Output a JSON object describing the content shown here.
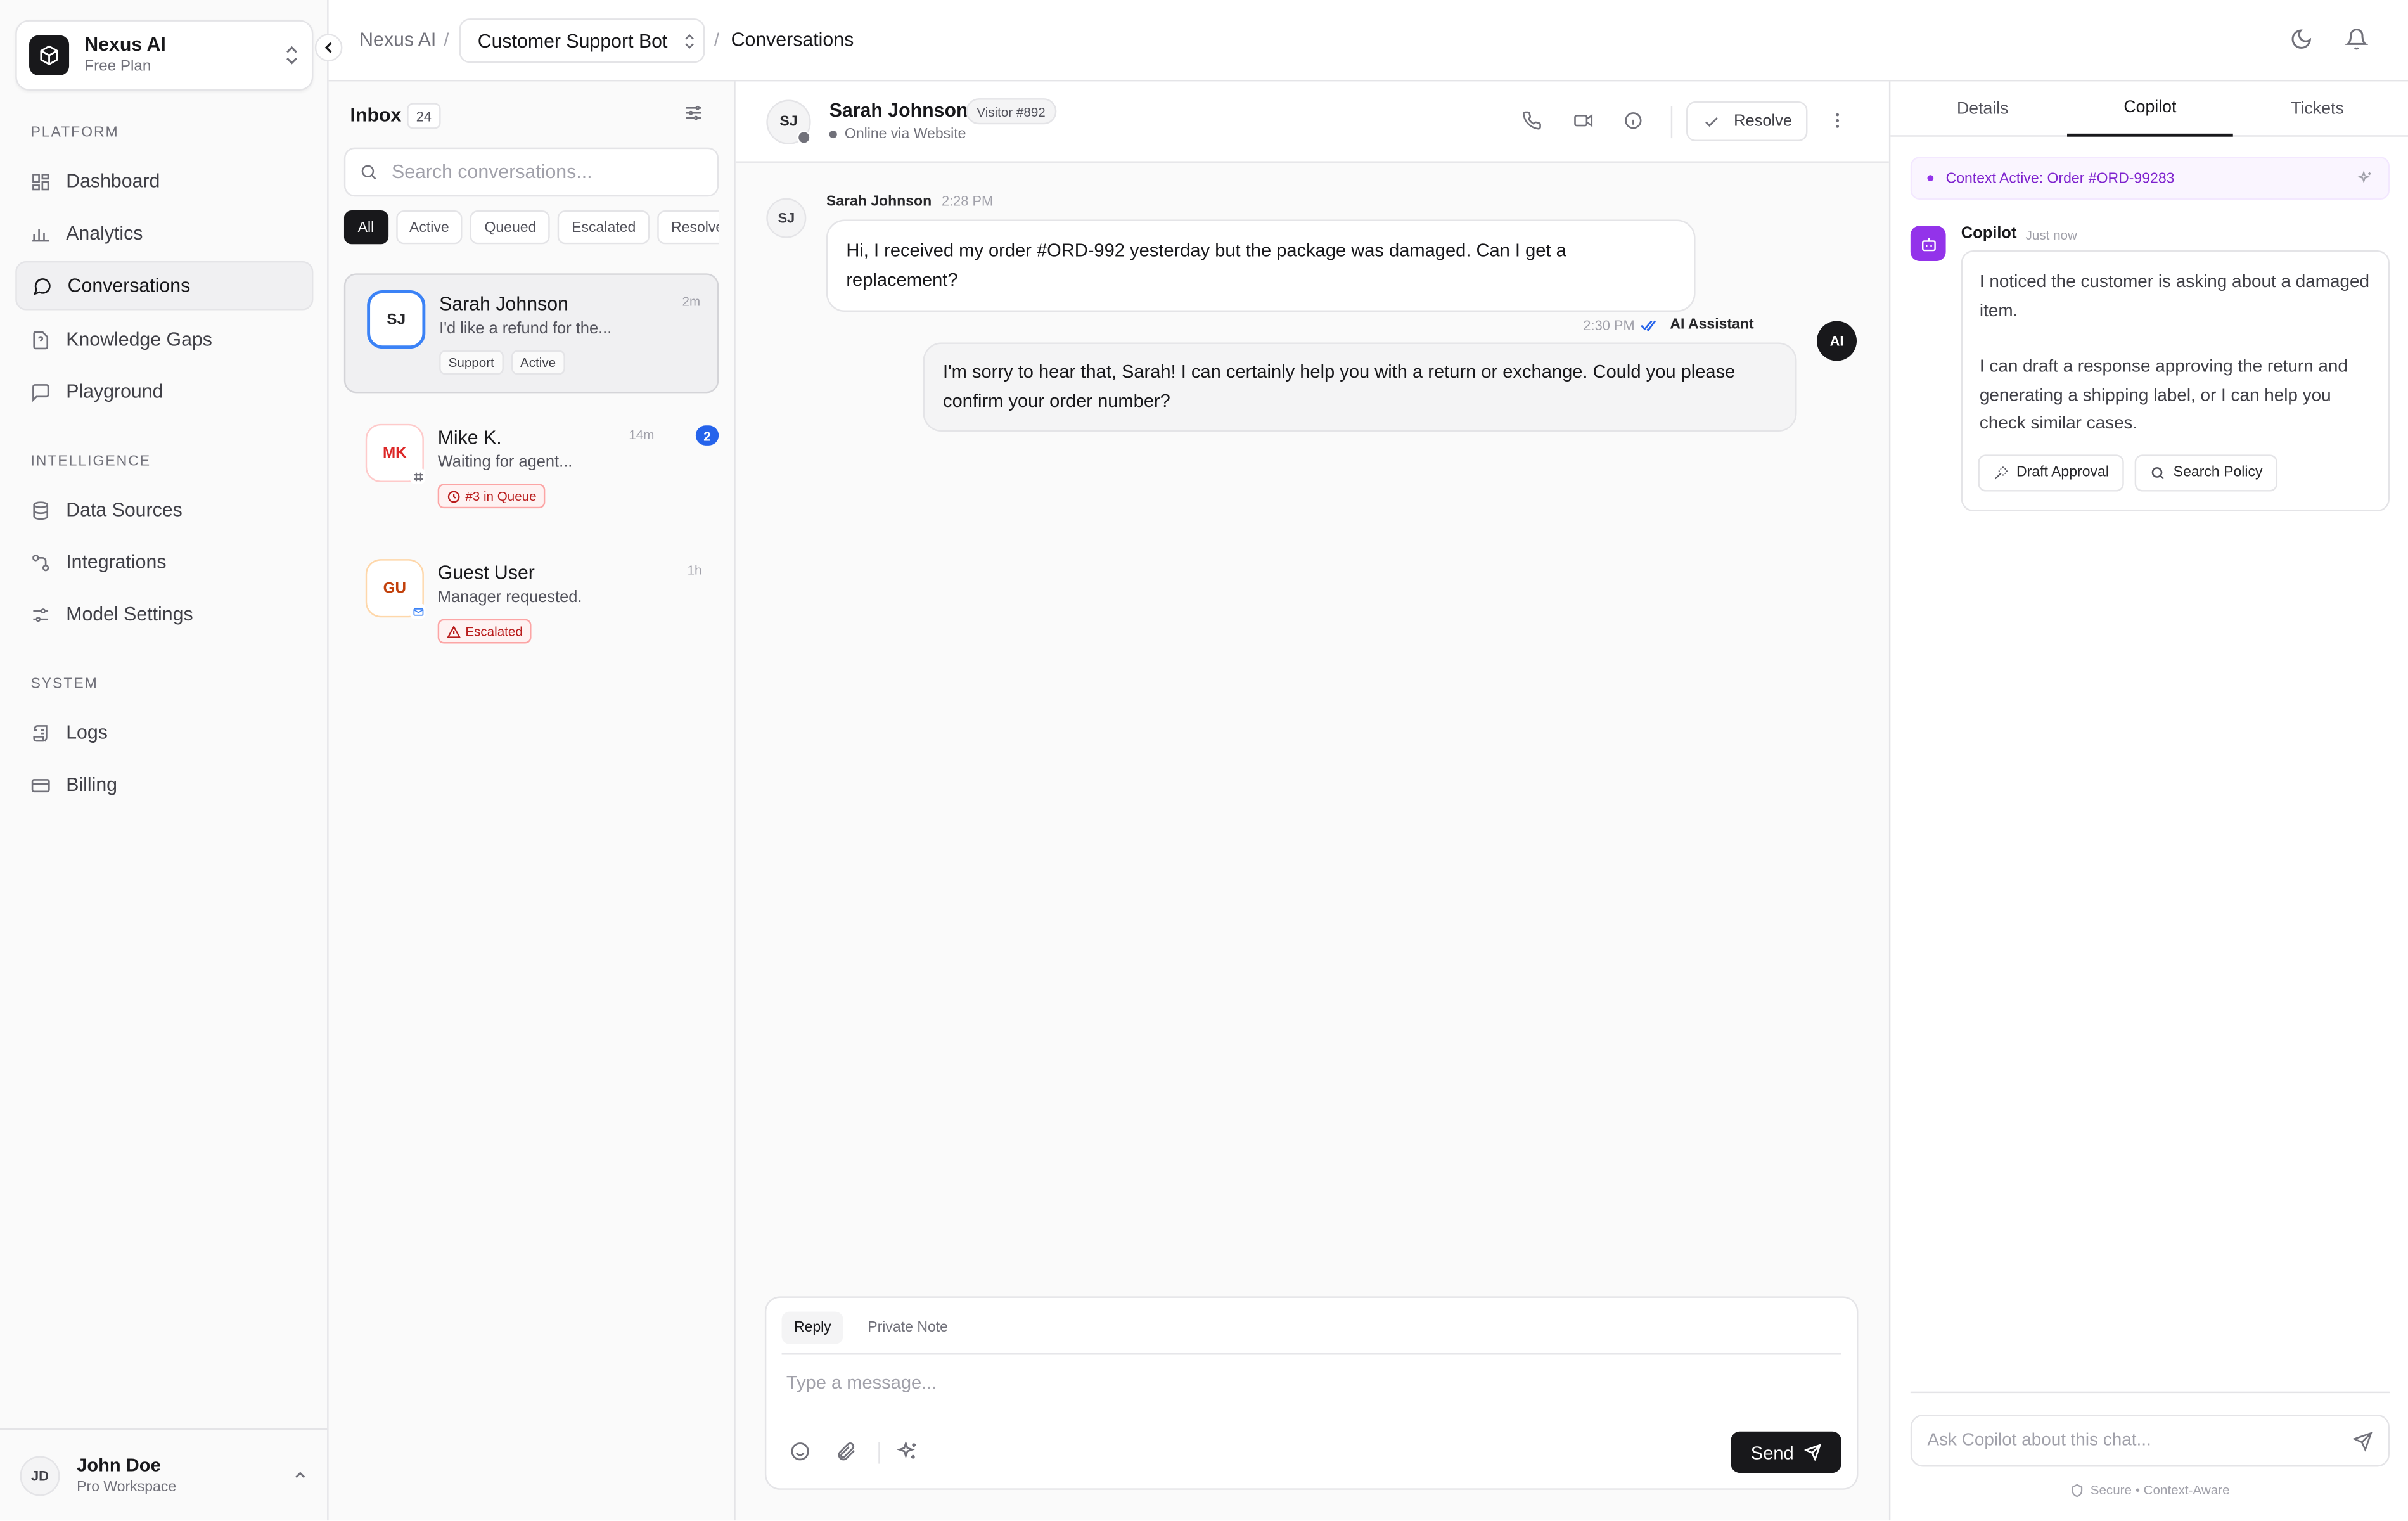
{
  "workspace": {
    "name": "Nexus AI",
    "plan": "Free Plan"
  },
  "sidebar": {
    "sections": [
      {
        "title": "PLATFORM",
        "items": [
          {
            "label": "Dashboard",
            "icon": "dashboard-icon"
          },
          {
            "label": "Analytics",
            "icon": "bar-chart-icon"
          },
          {
            "label": "Conversations",
            "icon": "message-circle-icon",
            "active": true
          },
          {
            "label": "Knowledge Gaps",
            "icon": "file-question-icon"
          },
          {
            "label": "Playground",
            "icon": "message-square-icon"
          }
        ]
      },
      {
        "title": "INTELLIGENCE",
        "items": [
          {
            "label": "Data Sources",
            "icon": "database-icon"
          },
          {
            "label": "Integrations",
            "icon": "plug-icon"
          },
          {
            "label": "Model Settings",
            "icon": "sliders-icon"
          }
        ]
      },
      {
        "title": "SYSTEM",
        "items": [
          {
            "label": "Logs",
            "icon": "scroll-icon"
          },
          {
            "label": "Billing",
            "icon": "credit-card-icon"
          }
        ]
      }
    ]
  },
  "user": {
    "initials": "JD",
    "name": "John Doe",
    "workspace": "Pro Workspace"
  },
  "topbar": {
    "breadcrumb_root": "Nexus AI",
    "bot_select": "Customer Support Bot",
    "current": "Conversations",
    "separator": "/"
  },
  "inbox": {
    "title": "Inbox",
    "count": "24",
    "search_placeholder": "Search conversations...",
    "filters": [
      "All",
      "Active",
      "Queued",
      "Escalated",
      "Resolved"
    ],
    "conversations": [
      {
        "initials": "SJ",
        "name": "Sarah Johnson",
        "time": "2m",
        "preview": "I'd like a refund for the...",
        "tags": [
          "Support",
          "Active"
        ]
      },
      {
        "initials": "MK",
        "name": "Mike K.",
        "time": "14m",
        "preview": "Waiting for agent...",
        "tags": [
          "#3 in Queue"
        ],
        "unread": "2"
      },
      {
        "initials": "GU",
        "name": "Guest User",
        "time": "1h",
        "preview": "Manager requested.",
        "tags": [
          "Escalated"
        ]
      }
    ]
  },
  "chat": {
    "contact": {
      "initials": "SJ",
      "name": "Sarah Johnson",
      "visitor": "Visitor #892",
      "status": "Online via Website"
    },
    "resolve_label": "Resolve",
    "messages": [
      {
        "from": "customer",
        "initials": "SJ",
        "sender": "Sarah Johnson",
        "time": "2:28 PM",
        "text": "Hi, I received my order #ORD-992 yesterday but the package was damaged. Can I get a replacement?"
      },
      {
        "from": "ai",
        "initials": "AI",
        "sender": "AI Assistant",
        "time": "2:30 PM",
        "text": "I'm sorry to hear that, Sarah! I can certainly help you with a return or exchange. Could you please confirm your order number?"
      }
    ],
    "composer": {
      "tab_reply": "Reply",
      "tab_note": "Private Note",
      "placeholder": "Type a message...",
      "send_label": "Send"
    }
  },
  "copilot": {
    "tabs": [
      "Details",
      "Copilot",
      "Tickets"
    ],
    "context": "Context Active: Order #ORD-99283",
    "name": "Copilot",
    "time": "Just now",
    "message_p1": "I noticed the customer is asking about a damaged item.",
    "message_p2": "I can draft a response approving the return and generating a shipping label, or I can help you check similar cases.",
    "actions": [
      "Draft Approval",
      "Search Policy"
    ],
    "ask_placeholder": "Ask Copilot about this chat...",
    "footer": "Secure • Context-Aware"
  },
  "colors": {
    "accent_purple": "#9333ea",
    "unread_blue": "#2563eb",
    "escalated_red": "#b91c1c",
    "primary_dark": "#18181b"
  }
}
